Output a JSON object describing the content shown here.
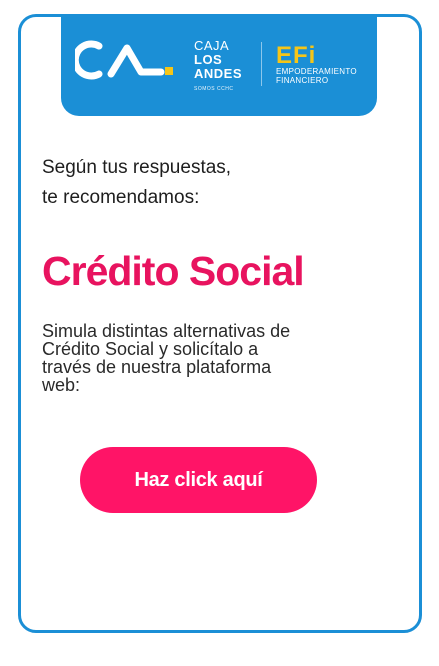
{
  "brand": {
    "line1": "CAJA",
    "line2": "LOS",
    "line3": "ANDES",
    "tagline": "SOMOS CCHC",
    "efi_logo": "EFi",
    "efi_sub1": "EMPODERAMIENTO",
    "efi_sub2": "FINANCIERO"
  },
  "intro": {
    "line1": "Según tus respuestas,",
    "line2": "te recomendamos:"
  },
  "product": {
    "title": "Crédito Social"
  },
  "description": {
    "line1": "Simula distintas alternativas de",
    "line2": "Crédito Social y solicítalo a",
    "line3": "través de nuestra plataforma",
    "line4": "web:"
  },
  "cta": {
    "label": "Haz click aquí"
  },
  "colors": {
    "brand_blue": "#1b8fd6",
    "accent_pink": "#e8135f",
    "button_pink": "#ff1467",
    "efi_yellow": "#f5c518"
  }
}
